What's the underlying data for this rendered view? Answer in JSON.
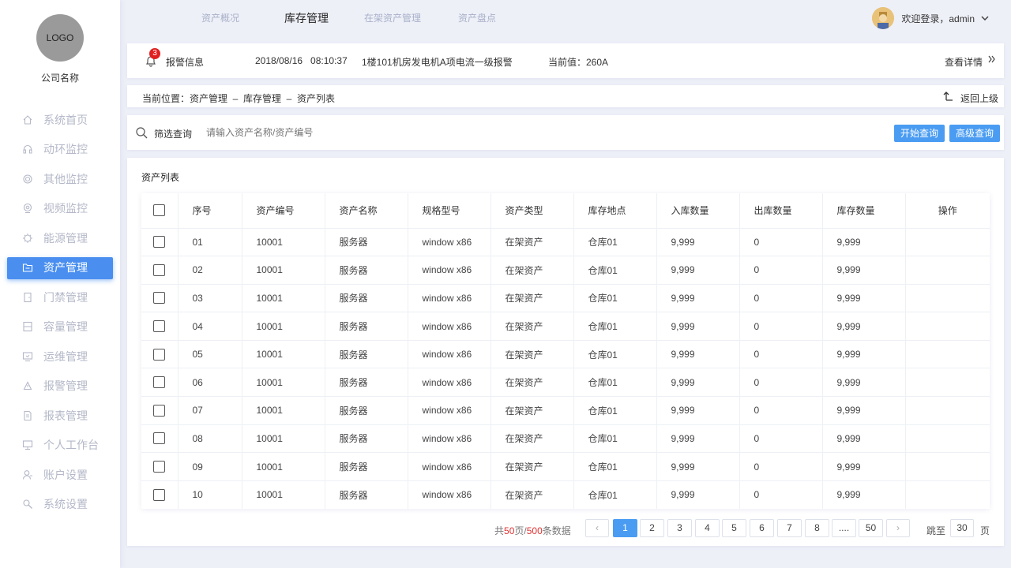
{
  "sidebar": {
    "logo": "LOGO",
    "company": "公司名称",
    "items": [
      {
        "label": "系统首页",
        "icon": "home-icon"
      },
      {
        "label": "动环监控",
        "icon": "headset-icon"
      },
      {
        "label": "其他监控",
        "icon": "target-icon"
      },
      {
        "label": "视频监控",
        "icon": "camera-icon"
      },
      {
        "label": "能源管理",
        "icon": "energy-icon"
      },
      {
        "label": "资产管理",
        "icon": "folder-icon",
        "active": true
      },
      {
        "label": "门禁管理",
        "icon": "door-icon"
      },
      {
        "label": "容量管理",
        "icon": "capacity-icon"
      },
      {
        "label": "运维管理",
        "icon": "monitor-icon"
      },
      {
        "label": "报警管理",
        "icon": "alarm-icon"
      },
      {
        "label": "报表管理",
        "icon": "report-icon"
      },
      {
        "label": "个人工作台",
        "icon": "desktop-icon"
      },
      {
        "label": "账户设置",
        "icon": "user-icon"
      },
      {
        "label": "系统设置",
        "icon": "settings-icon"
      }
    ]
  },
  "topnav": {
    "tabs": [
      "资产概况",
      "库存管理",
      "在架资产管理",
      "资产盘点"
    ],
    "active": "库存管理",
    "user_text": "欢迎登录，admin"
  },
  "alert": {
    "badge": "3",
    "label": "报警信息",
    "datetime": "2018/08/16   08:10:37",
    "message": "1楼101机房发电机A项电流一级报警",
    "current_value": "当前值：260A",
    "detail_link": "查看详情"
  },
  "breadcrumb": {
    "text": "当前位置：资产管理  –  库存管理  –  资产列表",
    "back": "返回上级"
  },
  "filter": {
    "label": "筛选查询",
    "placeholder": "请输入资产名称/资产编号",
    "search_button": "开始查询",
    "advanced_button": "高级查询"
  },
  "list": {
    "title": "资产列表",
    "columns": [
      "序号",
      "资产编号",
      "资产名称",
      "规格型号",
      "资产类型",
      "库存地点",
      "入库数量",
      "出库数量",
      "库存数量",
      "操作"
    ],
    "rows": [
      [
        "01",
        "10001",
        "服务器",
        "window x86",
        "在架资产",
        "仓库01",
        "9,999",
        "0",
        "9,999",
        ""
      ],
      [
        "02",
        "10001",
        "服务器",
        "window x86",
        "在架资产",
        "仓库01",
        "9,999",
        "0",
        "9,999",
        ""
      ],
      [
        "03",
        "10001",
        "服务器",
        "window x86",
        "在架资产",
        "仓库01",
        "9,999",
        "0",
        "9,999",
        ""
      ],
      [
        "04",
        "10001",
        "服务器",
        "window x86",
        "在架资产",
        "仓库01",
        "9,999",
        "0",
        "9,999",
        ""
      ],
      [
        "05",
        "10001",
        "服务器",
        "window x86",
        "在架资产",
        "仓库01",
        "9,999",
        "0",
        "9,999",
        ""
      ],
      [
        "06",
        "10001",
        "服务器",
        "window x86",
        "在架资产",
        "仓库01",
        "9,999",
        "0",
        "9,999",
        ""
      ],
      [
        "07",
        "10001",
        "服务器",
        "window x86",
        "在架资产",
        "仓库01",
        "9,999",
        "0",
        "9,999",
        ""
      ],
      [
        "08",
        "10001",
        "服务器",
        "window x86",
        "在架资产",
        "仓库01",
        "9,999",
        "0",
        "9,999",
        ""
      ],
      [
        "09",
        "10001",
        "服务器",
        "window x86",
        "在架资产",
        "仓库01",
        "9,999",
        "0",
        "9,999",
        ""
      ],
      [
        "10",
        "10001",
        "服务器",
        "window x86",
        "在架资产",
        "仓库01",
        "9,999",
        "0",
        "9,999",
        ""
      ]
    ]
  },
  "pagination": {
    "summary_prefix": "共",
    "total_pages": "50",
    "summary_mid": "页/",
    "total_items": "500",
    "summary_suffix": "条数据",
    "pages": [
      "1",
      "2",
      "3",
      "4",
      "5",
      "6",
      "7",
      "8",
      "....",
      "50"
    ],
    "current": "1",
    "prev": "‹",
    "next": "›",
    "jump_label": "跳至",
    "jump_value": "30",
    "jump_unit": "页"
  },
  "colors": {
    "accent": "#4a9cf2",
    "sidebar_active": "#4a8ff0",
    "badge": "#e02020",
    "page_bg": "#eef0f8"
  }
}
